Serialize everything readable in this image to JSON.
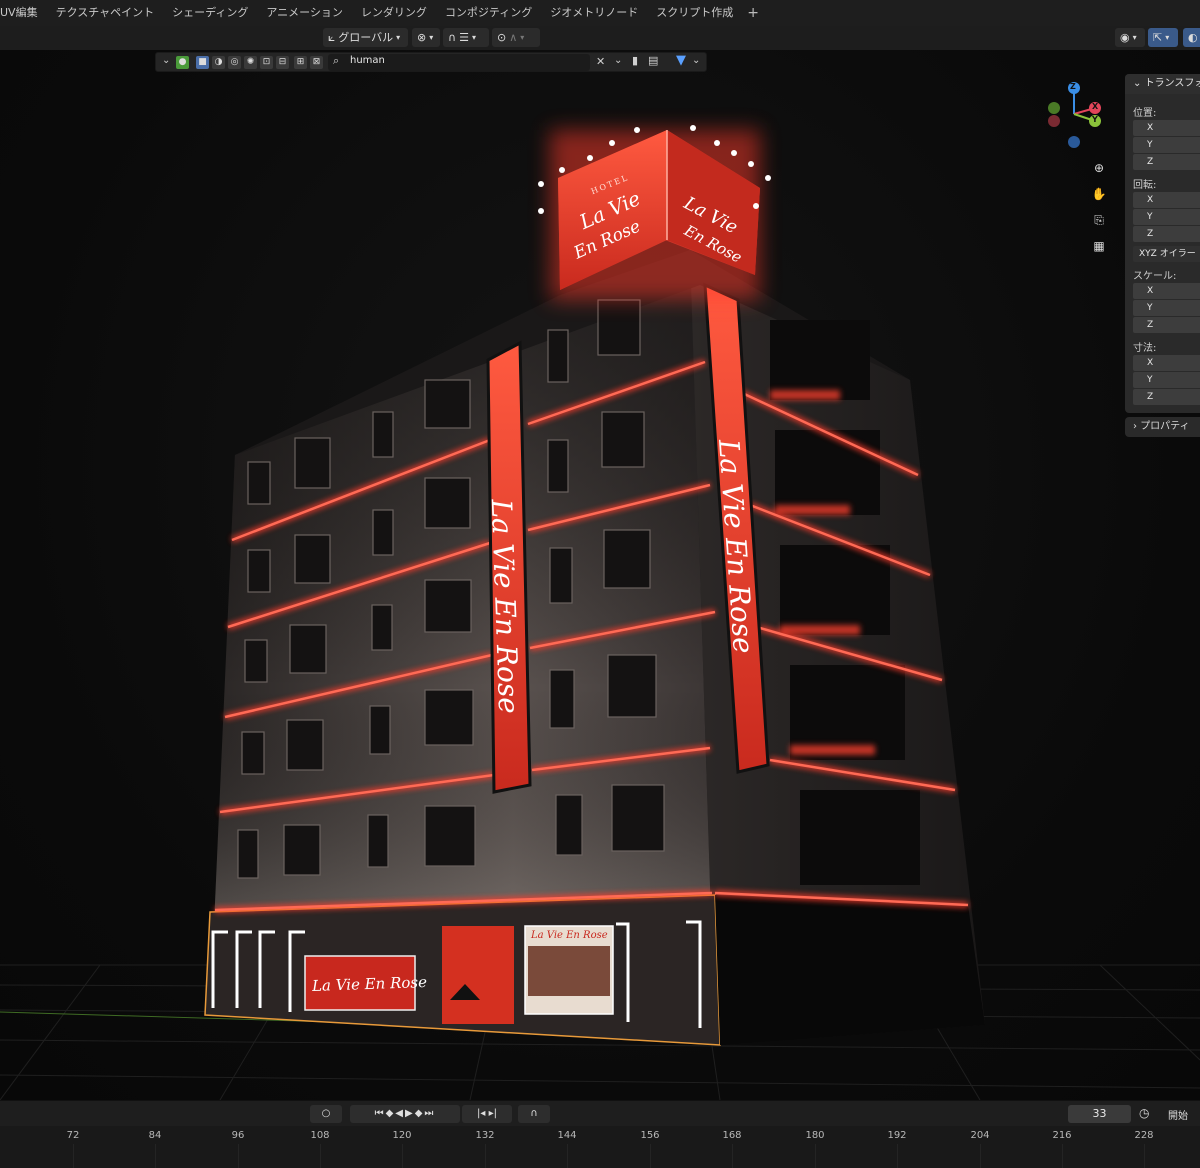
{
  "workspace_tabs": [
    "UV編集",
    "テクスチャペイント",
    "シェーディング",
    "アニメーション",
    "レンダリング",
    "コンポジティング",
    "ジオメトリノード",
    "スクリプト作成"
  ],
  "add_tab_symbol": "+",
  "header": {
    "transform_orientation": "グローバル"
  },
  "outliner": {
    "search_value": "human"
  },
  "npanel": {
    "title": "トランスフォ",
    "location_label": "位置:",
    "rotation_label": "回転:",
    "rotation_mode": "XYZ オイラー",
    "scale_label": "スケール:",
    "dimensions_label": "寸法:",
    "axes": [
      "X",
      "Y",
      "Z"
    ],
    "properties_label": "プロパティ"
  },
  "gizmo": {
    "z": "Z",
    "x": "X",
    "y": "Y",
    "x_color": "#e2455a",
    "y_color": "#8bc33a",
    "z_color": "#3a8ee6"
  },
  "scene_signage": {
    "hotel_small": "HOTEL",
    "brand_line1": "La Vie",
    "brand_line2": "En Rose",
    "brand_full": "La Vie En Rose",
    "accent_color": "#e23a2a"
  },
  "timeline": {
    "current_frame": "33",
    "start_label": "開始",
    "ticks": [
      "72",
      "84",
      "96",
      "108",
      "120",
      "132",
      "144",
      "156",
      "168",
      "180",
      "192",
      "204",
      "216",
      "228"
    ]
  }
}
